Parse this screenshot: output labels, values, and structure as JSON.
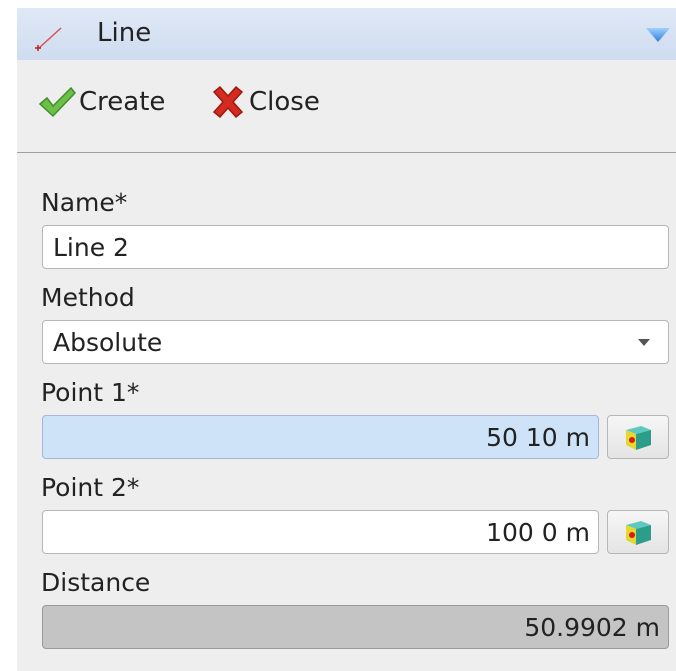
{
  "panel": {
    "title": "Line",
    "icons": {
      "title": "line-tool-icon",
      "collapse": "collapse-arrow-icon"
    }
  },
  "toolbar": {
    "create_label": "Create",
    "close_label": "Close",
    "icons": {
      "create": "checkmark-icon",
      "close": "red-x-icon"
    }
  },
  "form": {
    "name_label": "Name*",
    "name_value": "Line 2",
    "method_label": "Method",
    "method_value": "Absolute",
    "point1_label": "Point 1*",
    "point1_value": "50 10  m",
    "point2_label": "Point 2*",
    "point2_value": "100 0  m",
    "distance_label": "Distance",
    "distance_value": "50.9902  m",
    "pick_icon": "pick-point-cube-icon"
  },
  "colors": {
    "accent": "#4a90d9",
    "active_field": "#cfe3f8",
    "readonly_field": "#c4c4c4",
    "close_red": "#d42a20",
    "create_green": "#5bb33a"
  }
}
